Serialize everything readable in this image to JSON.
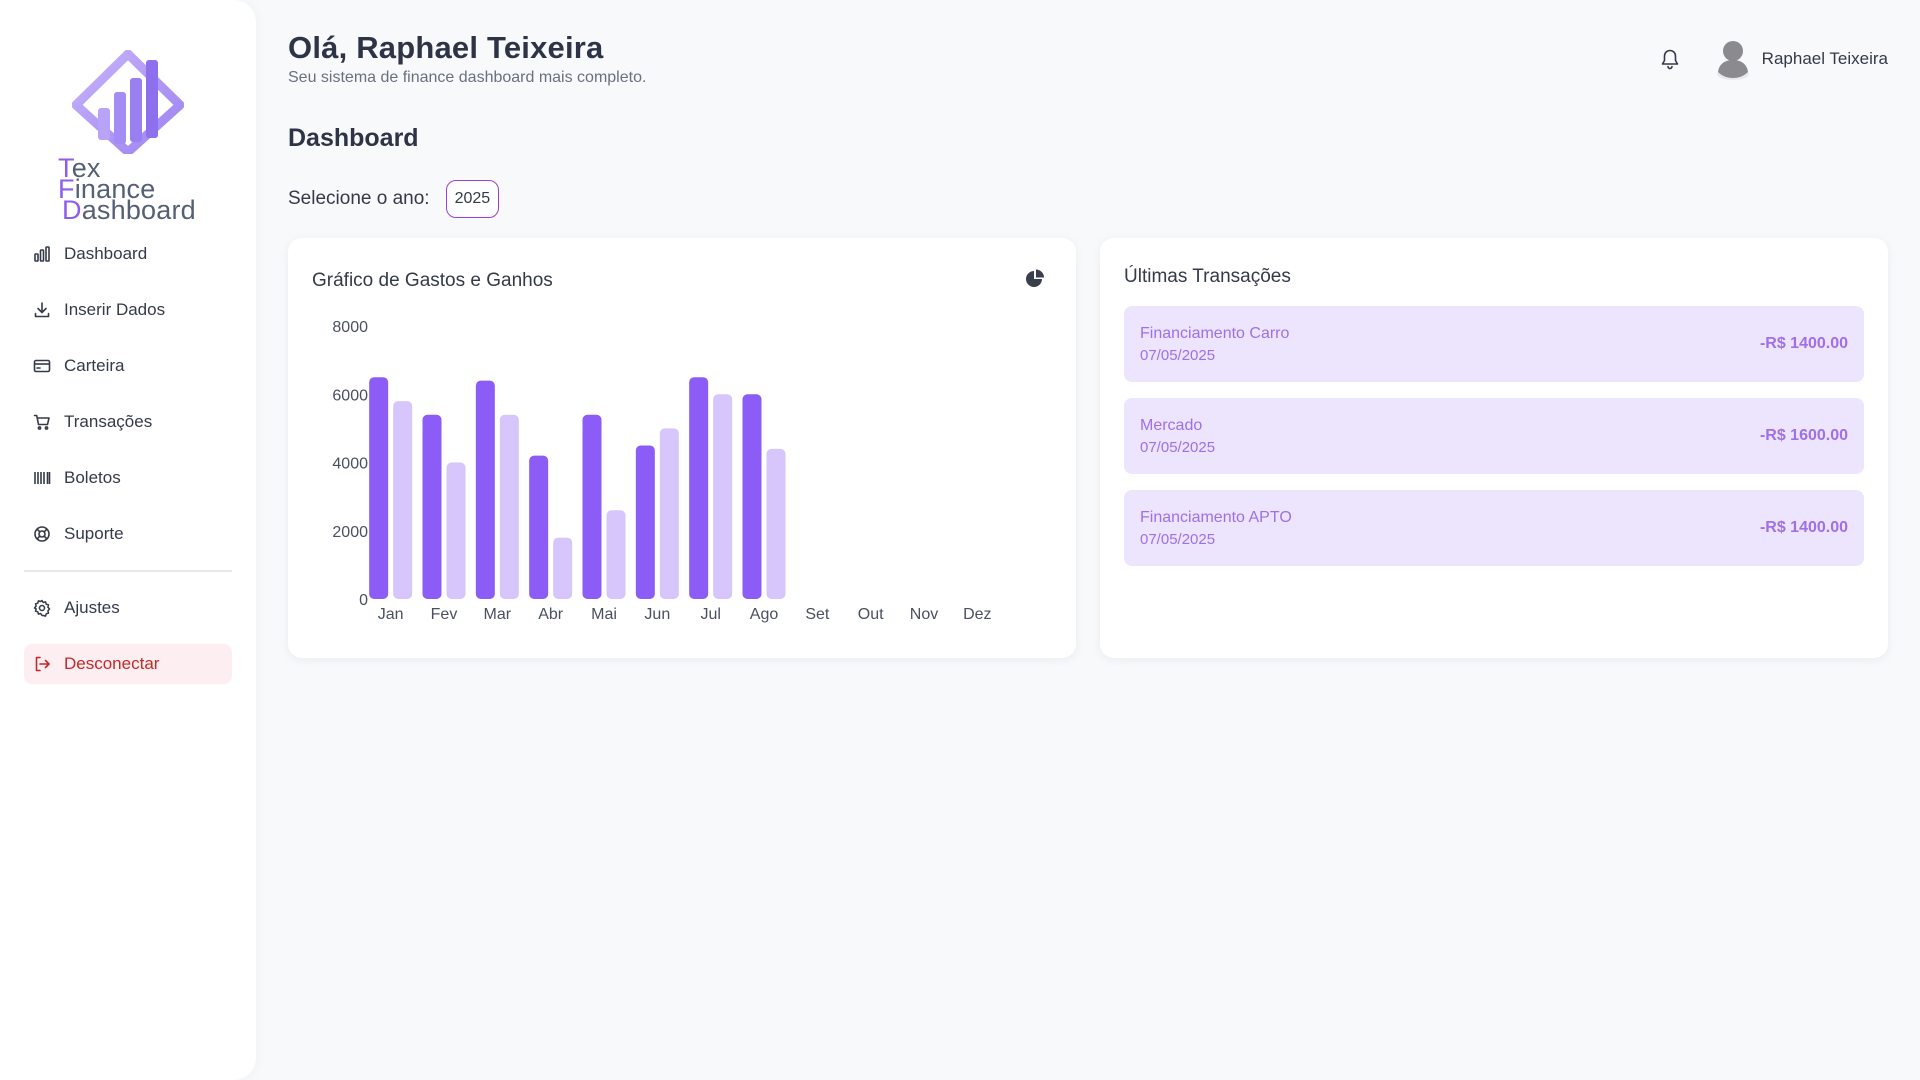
{
  "brand": {
    "line1_a": "T",
    "line1_b": "ex ",
    "line1_c": "F",
    "line1_d": "inance",
    "line2_a": "D",
    "line2_b": "ashboard"
  },
  "sidebar": {
    "items": [
      {
        "label": "Dashboard",
        "icon": "bar-chart-icon"
      },
      {
        "label": "Inserir Dados",
        "icon": "download-icon"
      },
      {
        "label": "Carteira",
        "icon": "wallet-icon"
      },
      {
        "label": "Transações",
        "icon": "cart-icon"
      },
      {
        "label": "Boletos",
        "icon": "barcode-icon"
      },
      {
        "label": "Suporte",
        "icon": "lifebuoy-icon"
      }
    ],
    "settings_label": "Ajustes",
    "logout_label": "Desconectar"
  },
  "header": {
    "greeting": "Olá, Raphael Teixeira",
    "subtitle": "Seu sistema de finance dashboard mais completo.",
    "user_name": "Raphael Teixeira"
  },
  "main": {
    "section_title": "Dashboard",
    "year_label": "Selecione o ano:",
    "year_value": "2025"
  },
  "chart_card": {
    "title": "Gráfico de Gastos e Ganhos"
  },
  "chart_data": {
    "type": "bar",
    "categories": [
      "Jan",
      "Fev",
      "Mar",
      "Abr",
      "Mai",
      "Jun",
      "Jul",
      "Ago",
      "Set",
      "Out",
      "Nov",
      "Dez"
    ],
    "series": [
      {
        "values": [
          6500,
          5400,
          6400,
          4200,
          5400,
          4500,
          6500,
          6000,
          0,
          0,
          0,
          0
        ]
      },
      {
        "values": [
          5800,
          4000,
          5400,
          1800,
          2600,
          5000,
          6000,
          4400,
          0,
          0,
          0,
          0
        ]
      }
    ],
    "y_ticks": [
      0,
      2000,
      4000,
      6000,
      8000
    ],
    "ylim": [
      0,
      8000
    ],
    "colors": [
      "#8b5cf6",
      "#d6c6fb"
    ],
    "grid": false
  },
  "transactions": {
    "title": "Últimas Transações",
    "items": [
      {
        "name": "Financiamento Carro",
        "date": "07/05/2025",
        "amount": "-R$ 1400.00"
      },
      {
        "name": "Mercado",
        "date": "07/05/2025",
        "amount": "-R$ 1600.00"
      },
      {
        "name": "Financiamento APTO",
        "date": "07/05/2025",
        "amount": "-R$ 1400.00"
      }
    ]
  }
}
